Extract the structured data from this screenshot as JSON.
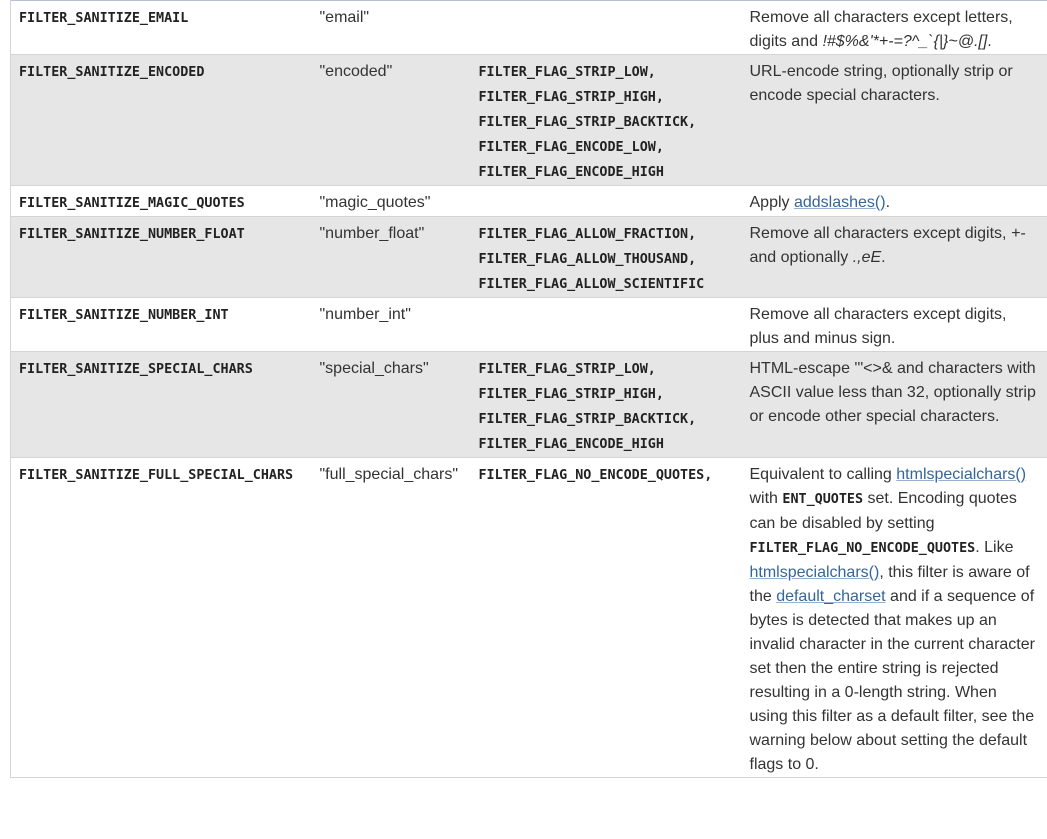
{
  "rows": [
    {
      "id": "FILTER_SANITIZE_EMAIL",
      "value": "\"email\"",
      "flags": [],
      "description": {
        "text": "Remove all characters except letters, digits and ",
        "chars": "!#$%&'*+-=?^_`{|}~@.[]",
        "end": "."
      }
    },
    {
      "id": "FILTER_SANITIZE_ENCODED",
      "value": "\"encoded\"",
      "flags": [
        "FILTER_FLAG_STRIP_LOW,",
        "FILTER_FLAG_STRIP_HIGH,",
        "FILTER_FLAG_STRIP_BACKTICK,",
        "FILTER_FLAG_ENCODE_LOW,",
        "FILTER_FLAG_ENCODE_HIGH"
      ],
      "description": "URL-encode string, optionally strip or encode special characters."
    },
    {
      "id": "FILTER_SANITIZE_MAGIC_QUOTES",
      "value": "\"magic_quotes\"",
      "flags": [],
      "description": {
        "before": "Apply ",
        "link": "addslashes()",
        "after": "."
      }
    },
    {
      "id": "FILTER_SANITIZE_NUMBER_FLOAT",
      "value": "\"number_float\"",
      "flags": [
        "FILTER_FLAG_ALLOW_FRACTION,",
        "FILTER_FLAG_ALLOW_THOUSAND,",
        "FILTER_FLAG_ALLOW_SCIENTIFIC"
      ],
      "description": {
        "text": "Remove all characters except digits, ",
        "chars1": "+-",
        "middle": " and optionally ",
        "chars2": ".,eE",
        "end": "."
      }
    },
    {
      "id": "FILTER_SANITIZE_NUMBER_INT",
      "value": "\"number_int\"",
      "flags": [],
      "description": "Remove all characters except digits, plus and minus sign."
    },
    {
      "id": "FILTER_SANITIZE_SPECIAL_CHARS",
      "value": "\"special_chars\"",
      "flags": [
        "FILTER_FLAG_STRIP_LOW,",
        "FILTER_FLAG_STRIP_HIGH,",
        "FILTER_FLAG_STRIP_BACKTICK,",
        "FILTER_FLAG_ENCODE_HIGH"
      ],
      "description": "HTML-escape '\"<>& and characters with ASCII value less than 32, optionally strip or encode other special characters."
    },
    {
      "id": "FILTER_SANITIZE_FULL_SPECIAL_CHARS",
      "value": "\"full_special_chars\"",
      "flags": [
        "FILTER_FLAG_NO_ENCODE_QUOTES,"
      ],
      "description": {
        "p1": "Equivalent to calling ",
        "link1": "htmlspecialchars()",
        "p2": " with ",
        "const1": "ENT_QUOTES",
        "p3": " set. Encoding quotes can be disabled by setting ",
        "const2": "FILTER_FLAG_NO_ENCODE_QUOTES",
        "p4": ". Like ",
        "link2": "htmlspecialchars()",
        "p5": ", this filter is aware of the ",
        "link3": "default_charset",
        "p6": " and if a sequence of bytes is detected that makes up an invalid character in the current character set then the entire string is rejected resulting in a 0-length string. When using this filter as a default filter, see the warning below about setting the default flags to 0."
      }
    }
  ]
}
